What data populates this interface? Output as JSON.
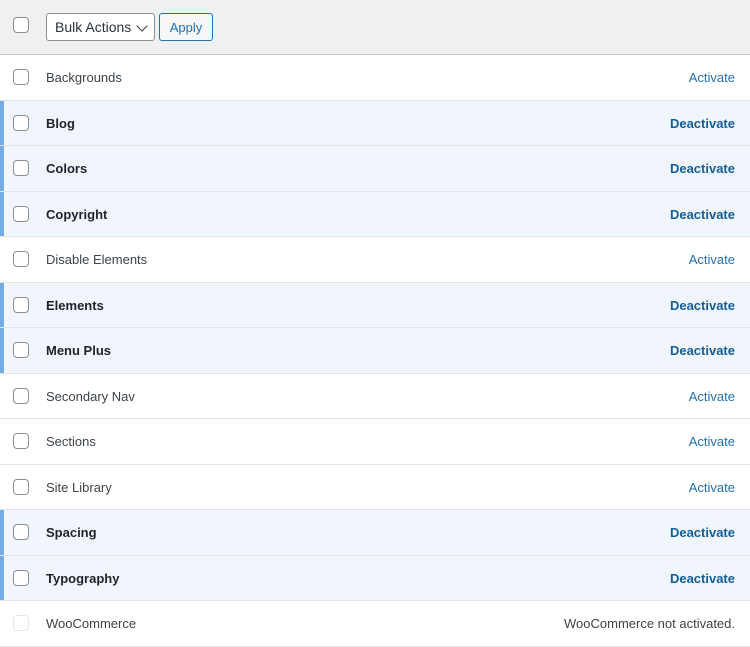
{
  "toolbar": {
    "bulk_actions_label": "Bulk Actions",
    "apply_label": "Apply"
  },
  "modules": [
    {
      "name": "Backgrounds",
      "action": "Activate",
      "active": false
    },
    {
      "name": "Blog",
      "action": "Deactivate",
      "active": true
    },
    {
      "name": "Colors",
      "action": "Deactivate",
      "active": true
    },
    {
      "name": "Copyright",
      "action": "Deactivate",
      "active": true
    },
    {
      "name": "Disable Elements",
      "action": "Activate",
      "active": false
    },
    {
      "name": "Elements",
      "action": "Deactivate",
      "active": true
    },
    {
      "name": "Menu Plus",
      "action": "Deactivate",
      "active": true
    },
    {
      "name": "Secondary Nav",
      "action": "Activate",
      "active": false
    },
    {
      "name": "Sections",
      "action": "Activate",
      "active": false
    },
    {
      "name": "Site Library",
      "action": "Activate",
      "active": false
    },
    {
      "name": "Spacing",
      "action": "Deactivate",
      "active": true
    },
    {
      "name": "Typography",
      "action": "Deactivate",
      "active": true
    },
    {
      "name": "WooCommerce",
      "action": "WooCommerce not activated.",
      "active": false,
      "disabled": true
    }
  ],
  "colors": {
    "active_row_bg": "#f0f6fc",
    "active_indicator": "#72aee6",
    "link": "#2271b1"
  }
}
